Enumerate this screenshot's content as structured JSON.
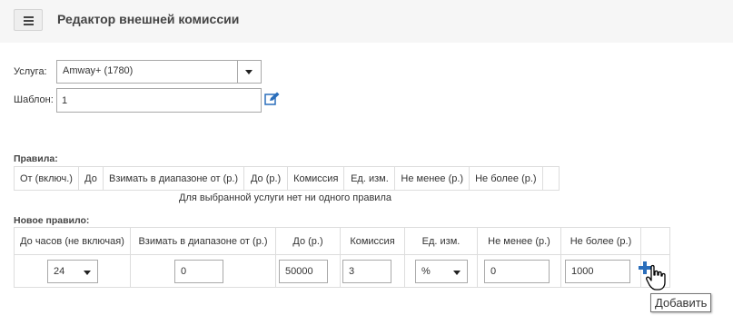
{
  "header": {
    "title": "Редактор внешней комиссии"
  },
  "form": {
    "service_label": "Услуга:",
    "service_value": "Amway+ (1780)",
    "template_label": "Шаблон:",
    "template_value": "1"
  },
  "rules": {
    "title": "Правила:",
    "columns": [
      "От (включ.)",
      "До",
      "Взимать в диапазоне от (р.)",
      "До (р.)",
      "Комиссия",
      "Ед. изм.",
      "Не менее (р.)",
      "Не более (р.)",
      ""
    ],
    "empty_message": "Для выбранной услуги нет ни одного правила"
  },
  "new_rule": {
    "title": "Новое правило:",
    "columns": [
      "До часов (не включая)",
      "Взимать в диапазоне от (р.)",
      "До (р.)",
      "Комиссия",
      "Ед. изм.",
      "Не менее (р.)",
      "Не более (р.)",
      ""
    ],
    "hours_value": "24",
    "range_from_value": "0",
    "range_to_value": "50000",
    "commission_value": "3",
    "unit_value": "%",
    "min_value": "0",
    "max_value": "1000"
  },
  "tooltip": {
    "add": "Добавить"
  },
  "icons": {
    "menu": "hamburger-icon",
    "edit": "edit-icon",
    "add": "plus-icon",
    "cursor": "hand-cursor-icon"
  },
  "colors": {
    "accent": "#2a6ebb",
    "border": "#dddddd"
  }
}
